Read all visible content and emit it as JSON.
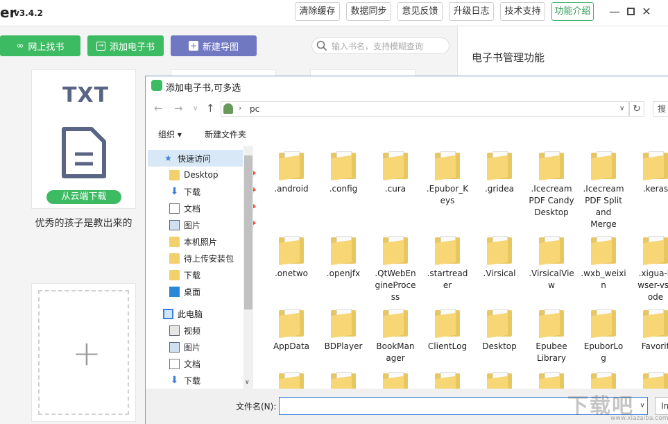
{
  "app": {
    "name": "er",
    "version": "v3.4.2"
  },
  "titlebar_buttons": [
    "清除缓存",
    "数据同步",
    "意见反馈",
    "升级日志",
    "技术支持",
    "功能介绍"
  ],
  "toolbar": {
    "find_online": "网上找书",
    "add_ebook": "添加电子书",
    "new_mindmap": "新建导图",
    "search_placeholder": "输入书名，支持模糊查询"
  },
  "right_panel": {
    "title": "电子书管理功能"
  },
  "book_card": {
    "format": "TXT",
    "download_label": "从云端下载",
    "title": "优秀的孩子是教出来的"
  },
  "dialog": {
    "title": "添加电子书,可多选",
    "path": "pc",
    "search_label": "搜",
    "organize": "组织 ▾",
    "new_folder": "新建文件夹",
    "nav": [
      {
        "label": "快速访问",
        "icon": "star-icon",
        "pinned": false,
        "selected": true
      },
      {
        "label": "Desktop",
        "icon": "folder-icon",
        "pinned": true
      },
      {
        "label": "下载",
        "icon": "download-icon",
        "pinned": true
      },
      {
        "label": "文档",
        "icon": "document-icon",
        "pinned": true
      },
      {
        "label": "图片",
        "icon": "picture-icon",
        "pinned": true
      },
      {
        "label": "本机照片",
        "icon": "folder-icon",
        "pinned": false
      },
      {
        "label": "待上传安装包",
        "icon": "folder-icon",
        "pinned": false
      },
      {
        "label": "下载",
        "icon": "folder-icon",
        "pinned": false
      },
      {
        "label": "桌面",
        "icon": "desktop-icon",
        "pinned": false
      },
      {
        "label": "此电脑",
        "icon": "computer-icon",
        "pinned": false
      },
      {
        "label": "视频",
        "icon": "video-icon",
        "pinned": false
      },
      {
        "label": "图片",
        "icon": "picture-icon",
        "pinned": false
      },
      {
        "label": "文档",
        "icon": "document-icon",
        "pinned": false
      },
      {
        "label": "下载",
        "icon": "download-icon",
        "pinned": false
      }
    ],
    "files": [
      [
        ".android",
        ".config",
        ".cura",
        ".Epubor_K\neys",
        ".gridea",
        ".Icecream\nPDF Candy\nDesktop",
        ".Icecream\nPDF Split\nand\nMerge",
        ".keras"
      ],
      [
        ".onetwo",
        ".openjfx",
        ".QtWebEn\ngineProce\nss",
        ".startread\ner",
        ".Virsical",
        ".VirsicalVie\nw",
        ".wxb_weixi\nn",
        ".xigua-b\nwser-vsc\node"
      ],
      [
        "AppData",
        "BDPlayer",
        "BookMan\nager",
        "ClientLog",
        "Desktop",
        "Epubee\nLibrary",
        "EpuborLo\ng",
        "Favorit"
      ]
    ],
    "filename_label": "文件名(N):",
    "filename_value": "",
    "filetype": "In"
  },
  "watermark": {
    "text": "下载吧",
    "url": "www.xiazaiba.com"
  }
}
